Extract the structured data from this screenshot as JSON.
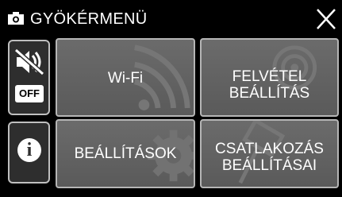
{
  "header": {
    "title": "GYÖKÉRMENÜ",
    "camera_icon": "camera-icon",
    "close_icon": "close-icon"
  },
  "side_panel": {
    "sound_icon": "no-sound-icon",
    "sound_badge": "OFF",
    "info_icon": "info-icon",
    "info_glyph": "i"
  },
  "tiles": [
    {
      "label": "Wi-Fi",
      "icon": "wifi-icon"
    },
    {
      "label_lines": [
        "FELVÉTEL",
        "BEÁLLÍTÁS"
      ],
      "icon": "record-icon"
    },
    {
      "label": "BEÁLLÍTÁSOK",
      "icon": "gear-icon"
    },
    {
      "label_lines": [
        "CSATLAKOZÁS",
        "BEÁLLÍTÁSAI"
      ],
      "icon": "connection-icon"
    }
  ],
  "colors": {
    "background": "#000000",
    "tile": "#636363",
    "tile_border": "#b5b5b5",
    "text": "#ffffff"
  }
}
